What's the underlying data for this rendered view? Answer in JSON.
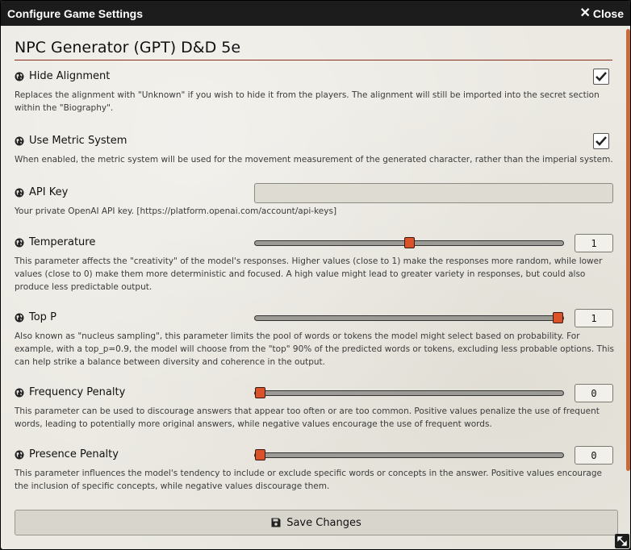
{
  "window": {
    "title": "Configure Game Settings",
    "close_label": "Close"
  },
  "module": {
    "title": "NPC Generator (GPT) D&D 5e"
  },
  "settings": {
    "hide_alignment": {
      "label": "Hide Alignment",
      "hint": "Replaces the alignment with \"Unknown\" if you wish to hide it from the players. The alignment will still be imported into the secret section within the \"Biography\".",
      "checked": true
    },
    "metric": {
      "label": "Use Metric System",
      "hint": "When enabled, the metric system will be used for the movement measurement of the generated character, rather than the imperial system.",
      "checked": true
    },
    "api_key": {
      "label": "API Key",
      "hint": "Your private OpenAI API key. [https://platform.openai.com/account/api-keys]",
      "value": ""
    },
    "temperature": {
      "label": "Temperature",
      "hint": "This parameter affects the \"creativity\" of the model's responses. Higher values (close to 1) make the responses more random, while lower values (close to 0) make them more deterministic and focused. A high value might lead to greater variety in responses, but could also produce less predictable output.",
      "value": "1",
      "fraction": 0.5
    },
    "top_p": {
      "label": "Top P",
      "hint": "Also known as \"nucleus sampling\", this parameter limits the pool of words or tokens the model might select based on probability. For example, with a top_p=0.9, the model will choose from the \"top\" 90% of the predicted words or tokens, excluding less probable options. This can help strike a balance between diversity and coherence in the output.",
      "value": "1",
      "fraction": 1.0
    },
    "frequency_penalty": {
      "label": "Frequency Penalty",
      "hint": "This parameter can be used to discourage answers that appear too often or are too common. Positive values penalize the use of frequent words, leading to potentially more original answers, while negative values encourage the use of frequent words.",
      "value": "0",
      "fraction": 0.0
    },
    "presence_penalty": {
      "label": "Presence Penalty",
      "hint": "This parameter influences the model's tendency to include or exclude specific words or concepts in the answer. Positive values encourage the inclusion of specific concepts, while negative values discourage them.",
      "value": "0",
      "fraction": 0.0
    }
  },
  "footer": {
    "save_label": "Save Changes"
  },
  "colors": {
    "accent": "#d9522a",
    "titlebar": "#1c1c1c",
    "heading_rule": "#8a2a1a"
  }
}
